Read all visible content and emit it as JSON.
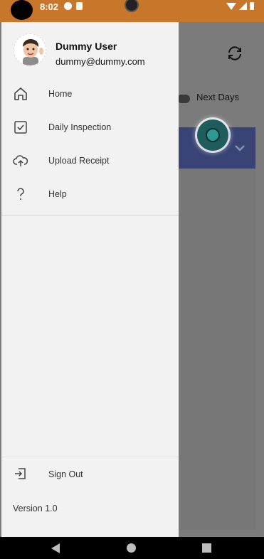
{
  "status_bar": {
    "time": "8:02"
  },
  "background": {
    "toggle_label": "Next Days"
  },
  "drawer": {
    "user_name": "Dummy User",
    "user_email": "dummy@dummy.com",
    "items": [
      {
        "label": "Home",
        "icon": "home-icon"
      },
      {
        "label": "Daily Inspection",
        "icon": "checkbox-icon"
      },
      {
        "label": "Upload Receipt",
        "icon": "cloud-upload-icon"
      },
      {
        "label": "Help",
        "icon": "help-icon"
      }
    ],
    "sign_out_label": "Sign Out",
    "version": "Version 1.0"
  },
  "colors": {
    "status_bar": "#c8762a",
    "drawer_bg": "#f2f2f2",
    "banner": "#3a4376",
    "fab": "#1f5d5c"
  }
}
